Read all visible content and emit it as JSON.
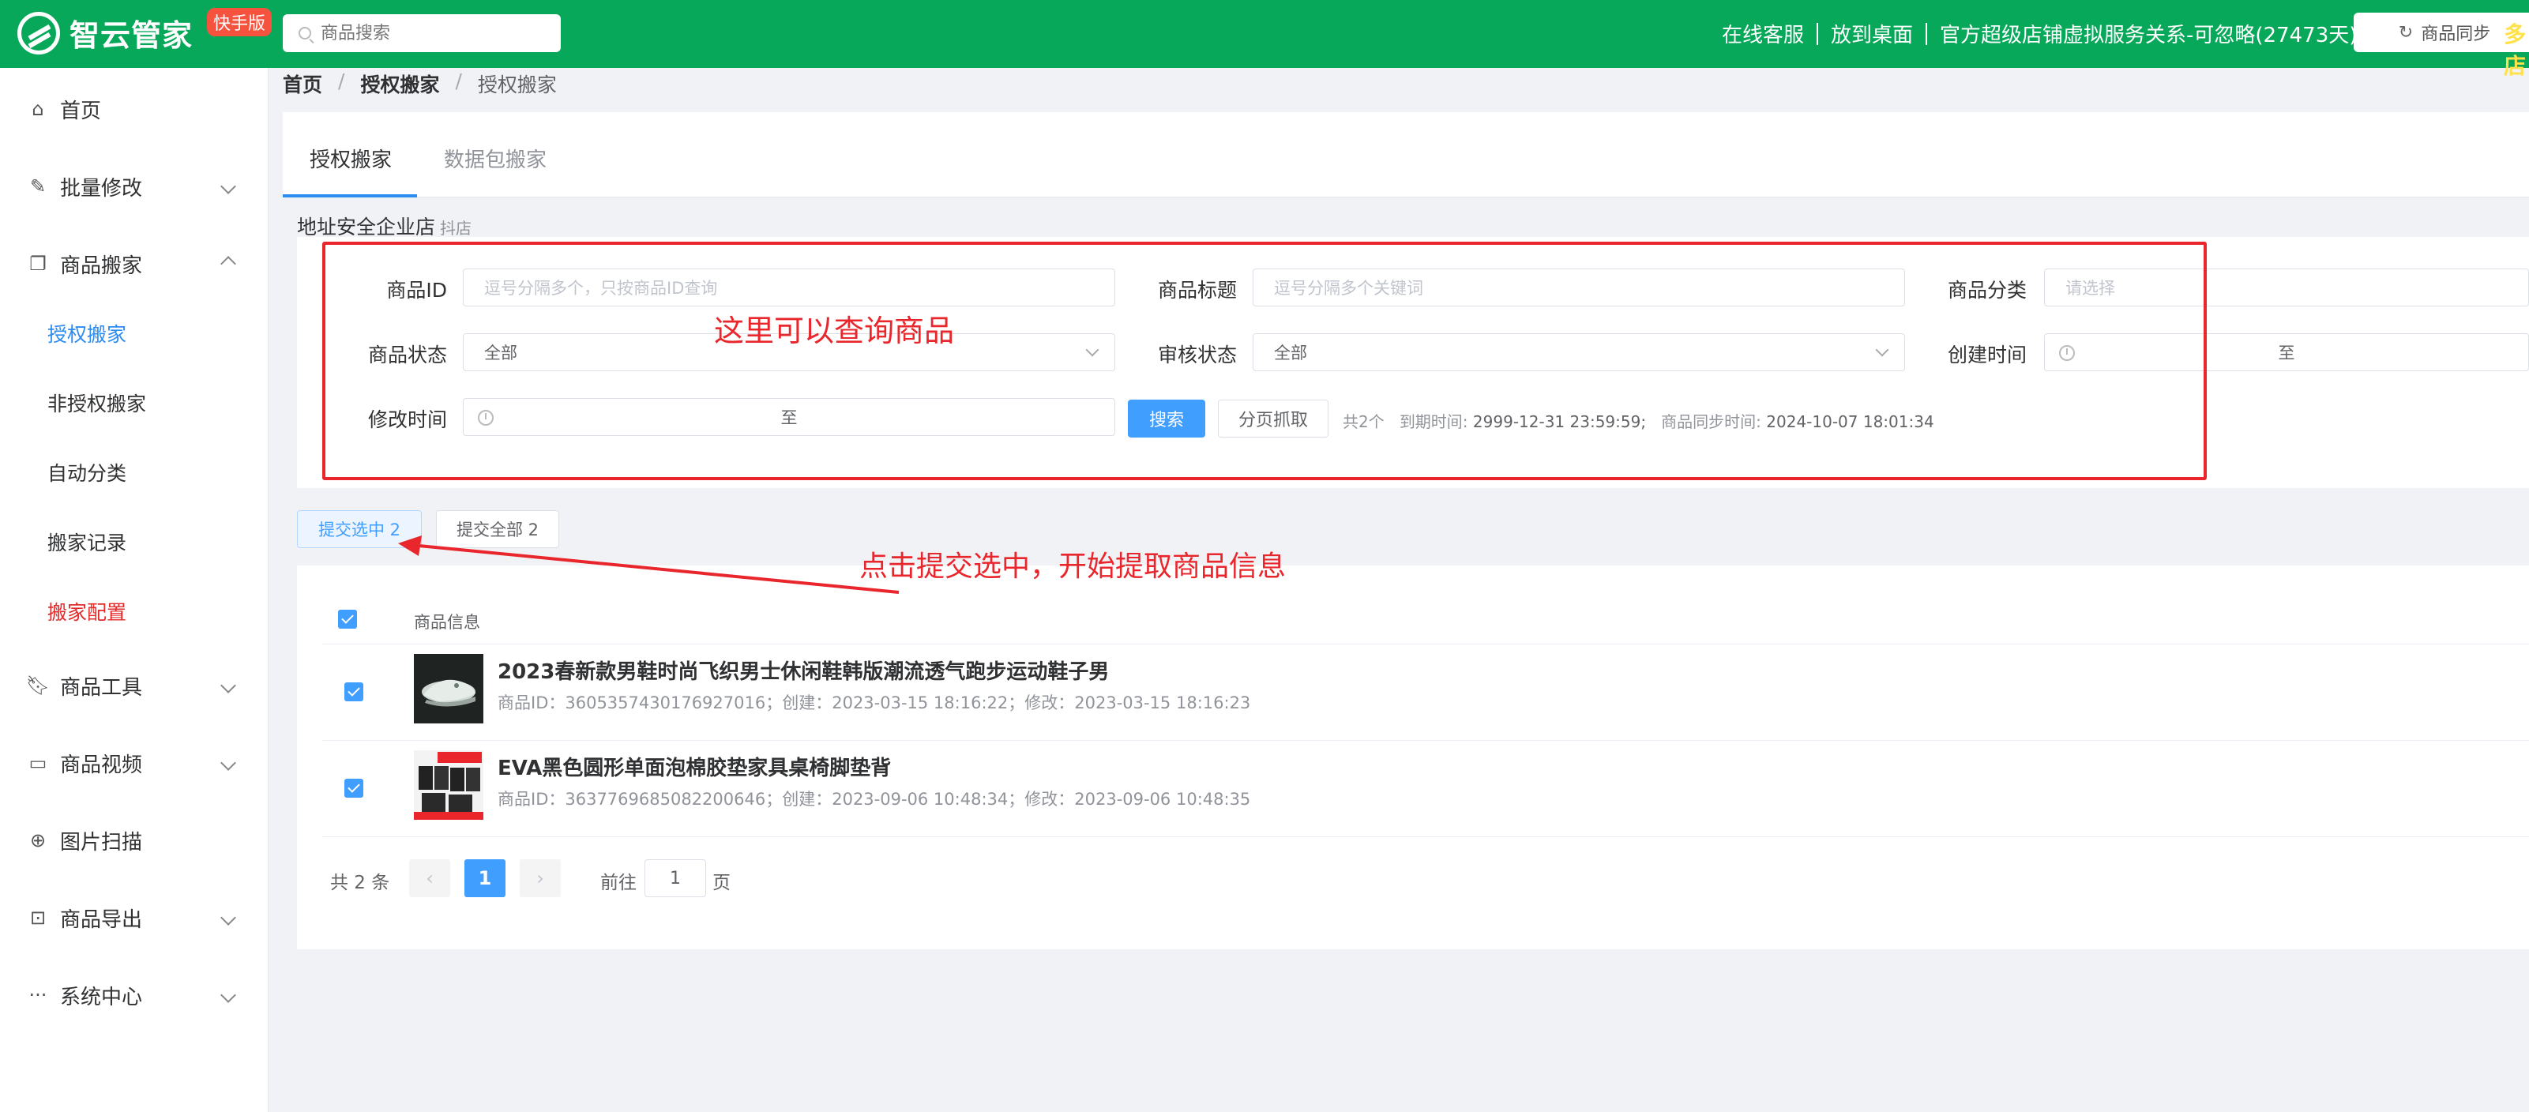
{
  "app": {
    "title": "智云管家",
    "badge": "快手版"
  },
  "search": {
    "placeholder": "商品搜索"
  },
  "top_links": [
    "在线客服",
    "放到桌面",
    "官方超级店铺虚拟服务关系-可忽略(27473天)"
  ],
  "sync_button": "商品同步",
  "more_tag": "多店",
  "sidebar": {
    "items": [
      {
        "label": "首页",
        "icon": "home-icon"
      },
      {
        "label": "批量修改",
        "icon": "edit-icon"
      },
      {
        "label": "商品搬家",
        "icon": "copy-icon"
      },
      {
        "label": "商品工具",
        "icon": "bookmark-icon"
      },
      {
        "label": "商品视频",
        "icon": "briefcase-icon"
      },
      {
        "label": "图片扫描",
        "icon": "crosshair-icon"
      },
      {
        "label": "商品导出",
        "icon": "bag-icon"
      },
      {
        "label": "系统中心",
        "icon": "dots-icon"
      }
    ],
    "sub_items": [
      "授权搬家",
      "非授权搬家",
      "自动分类",
      "搬家记录",
      "搬家配置"
    ]
  },
  "breadcrumb": [
    "首页",
    "授权搬家",
    "授权搬家"
  ],
  "tabs": [
    "授权搬家",
    "数据包搬家"
  ],
  "store": {
    "name": "地址安全企业店",
    "tag": "抖店"
  },
  "filters": {
    "product_id_label": "商品ID",
    "product_id_placeholder": "逗号分隔多个，只按商品ID查询",
    "title_label": "商品标题",
    "title_placeholder": "逗号分隔多个关键词",
    "category_label": "商品分类",
    "category_placeholder": "请选择",
    "status_label": "商品状态",
    "status_value": "全部",
    "audit_label": "审核状态",
    "audit_value": "全部",
    "created_label": "创建时间",
    "modified_label": "修改时间",
    "range_to": "至",
    "search_button": "搜索",
    "page_fetch_button": "分页抓取",
    "count_text": "共2个",
    "expire_label": "到期时间:",
    "expire_value": "2999-12-31 23:59:59;",
    "sync_label": "商品同步时间:",
    "sync_value": "2024-10-07 18:01:34"
  },
  "annotations": {
    "query": "这里可以查询商品",
    "submit": "点击提交选中，开始提取商品信息"
  },
  "submit_buttons": {
    "selected": "提交选中 2",
    "all": "提交全部 2"
  },
  "list": {
    "header": "商品信息",
    "rows": [
      {
        "name": "2023春新款男鞋时尚飞织男士休闲鞋韩版潮流透气跑步运动鞋子男",
        "meta": "商品ID：3605357430176927016；创建：2023-03-15 18:16:22；修改：2023-03-15 18:16:23"
      },
      {
        "name": "EVA黑色圆形单面泡棉胶垫家具桌椅脚垫背",
        "meta": "商品ID：3637769685082200646；创建：2023-09-06 10:48:34；修改：2023-09-06 10:48:35"
      }
    ]
  },
  "pagination": {
    "total": "共 2 条",
    "current": "1",
    "goto_label": "前往",
    "goto_value": "1",
    "goto_suffix": "页"
  },
  "colors": {
    "brand": "#07a85a",
    "accent": "#409eff",
    "annotation": "#e8262c"
  }
}
